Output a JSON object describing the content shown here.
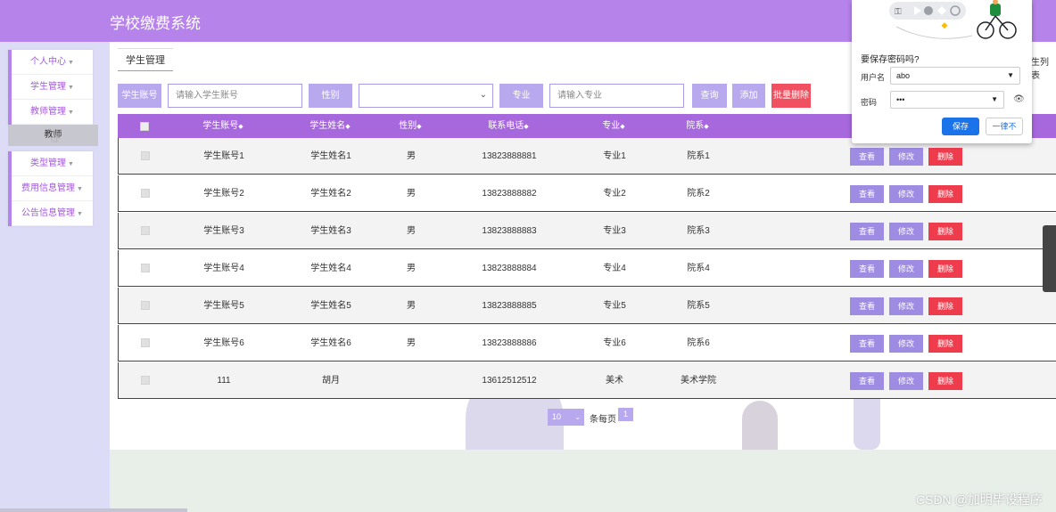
{
  "app": {
    "title": "学校缴费系统"
  },
  "sidebar": {
    "groups": [
      {
        "items": [
          "个人中心",
          "学生管理",
          "教师管理"
        ]
      },
      {
        "items": [
          "类型管理",
          "费用信息管理",
          "公告信息管理"
        ]
      }
    ],
    "active_sub_item": "教师"
  },
  "breadcrumb": {
    "current": "学生管理"
  },
  "list_label": "生列表",
  "search": {
    "account_label": "学生账号",
    "account_placeholder": "请输入学生账号",
    "gender_label": "性别",
    "gender_value": "",
    "major_label": "专业",
    "major_placeholder": "请输入专业",
    "query_btn": "查询",
    "add_btn": "添加",
    "batch_delete_btn": "批量删除"
  },
  "table": {
    "headers": [
      "学生账号",
      "学生姓名",
      "性别",
      "联系电话",
      "专业",
      "院系"
    ],
    "rows": [
      {
        "account": "学生账号1",
        "name": "学生姓名1",
        "gender": "男",
        "phone": "13823888881",
        "major": "专业1",
        "dept": "院系1"
      },
      {
        "account": "学生账号2",
        "name": "学生姓名2",
        "gender": "男",
        "phone": "13823888882",
        "major": "专业2",
        "dept": "院系2"
      },
      {
        "account": "学生账号3",
        "name": "学生姓名3",
        "gender": "男",
        "phone": "13823888883",
        "major": "专业3",
        "dept": "院系3"
      },
      {
        "account": "学生账号4",
        "name": "学生姓名4",
        "gender": "男",
        "phone": "13823888884",
        "major": "专业4",
        "dept": "院系4"
      },
      {
        "account": "学生账号5",
        "name": "学生姓名5",
        "gender": "男",
        "phone": "13823888885",
        "major": "专业5",
        "dept": "院系5"
      },
      {
        "account": "学生账号6",
        "name": "学生姓名6",
        "gender": "男",
        "phone": "13823888886",
        "major": "专业6",
        "dept": "院系6"
      },
      {
        "account": "111",
        "name": "胡月",
        "gender": "",
        "phone": "13612512512",
        "major": "美术",
        "dept": "美术学院"
      }
    ],
    "row_actions": {
      "view": "查看",
      "edit": "修改",
      "delete": "删除"
    }
  },
  "pagination": {
    "page_size": "10",
    "per_page_label": "条每页",
    "current_page": "1"
  },
  "password_popup": {
    "title": "要保存密码吗?",
    "username_label": "用户名",
    "username_value": "abo",
    "password_label": "密码",
    "password_value": "•••",
    "save_btn": "保存",
    "never_btn": "一律不"
  },
  "watermark": "CSDN @加明毕设程序",
  "colors": {
    "primary": "#b583ea",
    "header": "#a768de",
    "button": "#b8a9ef",
    "danger": "#f0505f",
    "chrome_blue": "#1a73e8"
  }
}
